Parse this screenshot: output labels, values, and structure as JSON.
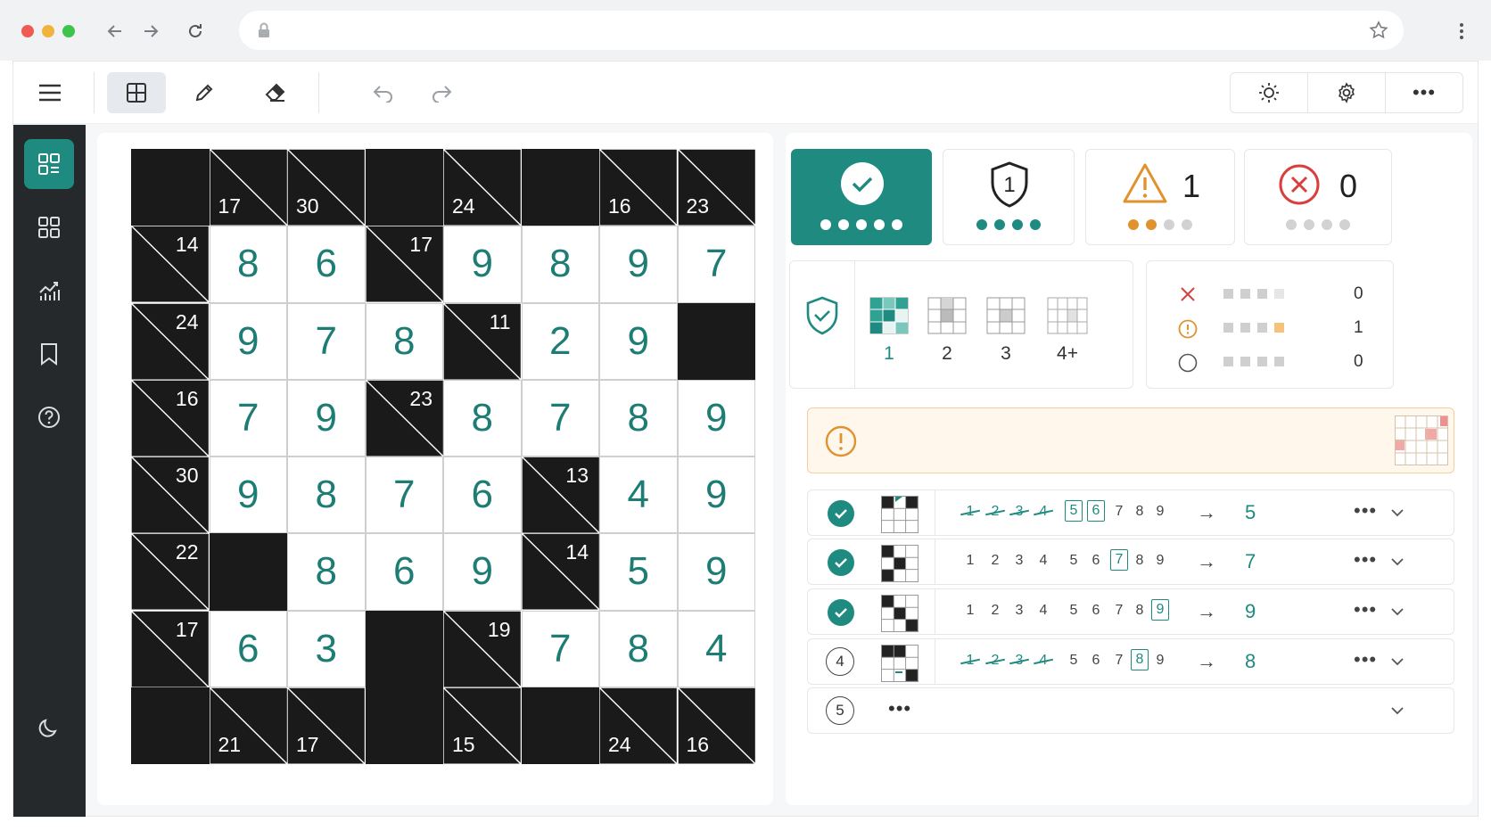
{
  "colors": {
    "accent": "#1e8a80",
    "warning": "#e0922e",
    "error": "#d8403e",
    "sidebar": "#26292c",
    "board_black": "#1a1a1a",
    "alert_bg": "#fff6ec"
  },
  "browser": {
    "icons": [
      "back-arrow-icon",
      "forward-arrow-icon",
      "reload-icon",
      "lock-icon",
      "bookmark-star-icon",
      "kebab-menu-icon"
    ]
  },
  "toolbar": {
    "tools": [
      "grid-icon",
      "pencil-icon",
      "eraser-icon",
      "undo-icon",
      "redo-icon"
    ],
    "right_group": [
      "brightness-icon",
      "settings-gear-icon",
      "more-horizontal-icon"
    ],
    "more_label": "•••"
  },
  "sidebar": {
    "items": [
      "dashboard-icon",
      "grid-apps-icon",
      "analytics-icon",
      "bookmark-icon",
      "help-icon"
    ],
    "bottom": "moon-icon"
  },
  "stats": {
    "solved_dots": 5,
    "shield_label": "1",
    "shield_dots": 4,
    "warnings_count": "1",
    "warning_dots_filled": 2,
    "warning_dots_total": 4,
    "errors_count": "0",
    "error_dots_total": 4
  },
  "techniques": {
    "labels": [
      "1",
      "2",
      "3",
      "4+"
    ]
  },
  "summary": {
    "rows": [
      {
        "icon": "x-icon",
        "value": "0"
      },
      {
        "icon": "warning-circle-icon",
        "value": "1"
      },
      {
        "icon": "empty-circle-icon",
        "value": "0"
      }
    ]
  },
  "steps": [
    {
      "status": "done",
      "candidates": [
        "1",
        "2",
        "3",
        "4",
        "5",
        "6",
        "7",
        "8",
        "9"
      ],
      "struck": [
        1,
        2,
        3,
        4
      ],
      "boxed": [
        5,
        6
      ],
      "result": "5"
    },
    {
      "status": "done",
      "candidates": [
        "1",
        "2",
        "3",
        "4",
        "5",
        "6",
        "7",
        "8",
        "9"
      ],
      "struck": [],
      "boxed": [
        7
      ],
      "result": "7"
    },
    {
      "status": "done",
      "candidates": [
        "1",
        "2",
        "3",
        "4",
        "5",
        "6",
        "7",
        "8",
        "9"
      ],
      "struck": [],
      "boxed": [
        9
      ],
      "result": "9"
    },
    {
      "status": "4",
      "candidates": [
        "1",
        "2",
        "3",
        "4",
        "5",
        "6",
        "7",
        "8",
        "9"
      ],
      "struck": [
        1,
        2,
        3,
        4
      ],
      "boxed": [
        8
      ],
      "result": "8"
    },
    {
      "status": "5",
      "pending": "•••"
    }
  ],
  "step_labels": {
    "arrow": "→",
    "more": "•••"
  },
  "puzzle": {
    "cells": [
      [
        "b",
        {
          "d": "17"
        },
        {
          "d": "30"
        },
        "b",
        {
          "d": "24"
        },
        "b",
        {
          "d": "16"
        },
        {
          "d": "23"
        }
      ],
      [
        {
          "r": "14"
        },
        "8",
        "6",
        {
          "r": "17"
        },
        "9",
        "8",
        "9",
        "7"
      ],
      [
        {
          "r": "24"
        },
        "9",
        "7",
        "8",
        {
          "r": "11"
        },
        "2",
        "9",
        "b"
      ],
      [
        {
          "r": "16"
        },
        "7",
        "9",
        {
          "r": "23"
        },
        "8",
        "7",
        "8",
        "9"
      ],
      [
        {
          "r": "30"
        },
        "9",
        "8",
        "7",
        "6",
        {
          "r": "13"
        },
        "4",
        "9"
      ],
      [
        {
          "r": "22"
        },
        "b",
        "8",
        "6",
        "9",
        {
          "r": "14"
        },
        "5",
        "9"
      ],
      [
        {
          "r": "17"
        },
        "6",
        "3",
        "b",
        {
          "r": "19"
        },
        "7",
        "8",
        "4"
      ],
      [
        "b",
        {
          "d": "21"
        },
        {
          "d": "17"
        },
        "b",
        {
          "d": "15"
        },
        "b",
        {
          "d": "24"
        },
        {
          "d": "16"
        }
      ]
    ]
  }
}
